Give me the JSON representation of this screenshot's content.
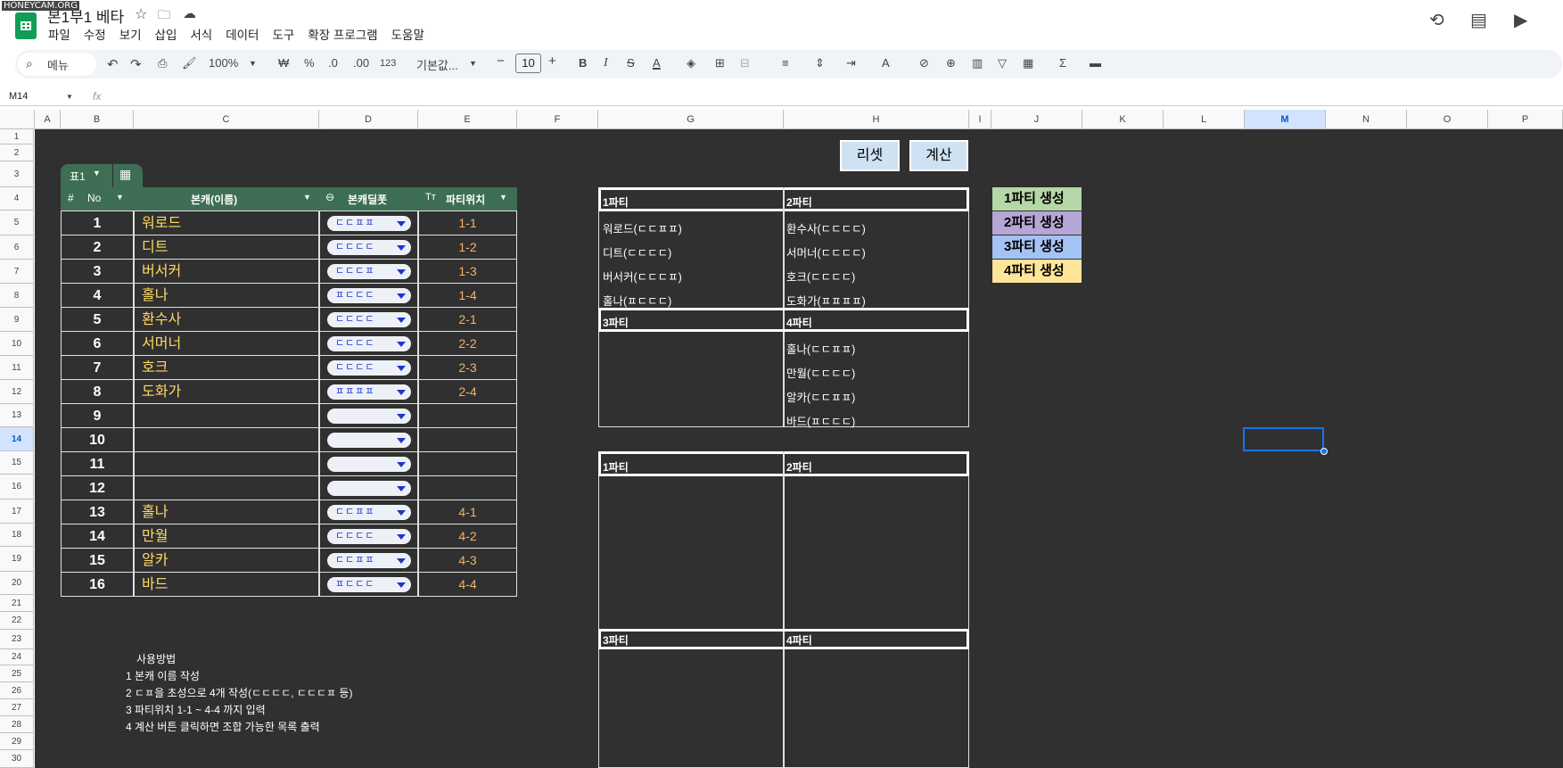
{
  "watermark": "HONEYCAM.ORG",
  "doc": {
    "title": "본1부1 베타"
  },
  "menu": [
    "파일",
    "수정",
    "보기",
    "삽입",
    "서식",
    "데이터",
    "도구",
    "확장 프로그램",
    "도움말"
  ],
  "toolbar": {
    "search_label": "메뉴",
    "zoom": "100%",
    "currency": "₩",
    "percent": "%",
    "dec_decrease": ".0",
    "dec_increase": ".00",
    "number_format": "123",
    "font": "기본값...",
    "font_size": "10"
  },
  "name_box": "M14",
  "fx_label": "fx",
  "columns": [
    "A",
    "B",
    "C",
    "D",
    "E",
    "F",
    "G",
    "H",
    "I",
    "J",
    "K",
    "L",
    "M",
    "N",
    "O",
    "P"
  ],
  "rows": [
    "1",
    "2",
    "3",
    "4",
    "5",
    "6",
    "7",
    "8",
    "9",
    "10",
    "11",
    "12",
    "13",
    "14",
    "15",
    "16",
    "17",
    "18",
    "19",
    "20",
    "21",
    "22",
    "23",
    "24",
    "25",
    "26",
    "27",
    "28",
    "29",
    "30"
  ],
  "buttons": {
    "reset": "리셋",
    "calc": "계산"
  },
  "table": {
    "tab_label": "표1",
    "headers": {
      "no": "No",
      "name": "본캐(이름)",
      "type": "본캐딜폿",
      "pos": "파티위치"
    },
    "rows": [
      {
        "no": "1",
        "name": "워로드",
        "chip": "ㄷㄷㅍㅍ",
        "pos": "1-1"
      },
      {
        "no": "2",
        "name": "디트",
        "chip": "ㄷㄷㄷㄷ",
        "pos": "1-2"
      },
      {
        "no": "3",
        "name": "버서커",
        "chip": "ㄷㄷㄷㅍ",
        "pos": "1-3"
      },
      {
        "no": "4",
        "name": "홀나",
        "chip": "ㅍㄷㄷㄷ",
        "pos": "1-4"
      },
      {
        "no": "5",
        "name": "환수사",
        "chip": "ㄷㄷㄷㄷ",
        "pos": "2-1"
      },
      {
        "no": "6",
        "name": "서머너",
        "chip": "ㄷㄷㄷㄷ",
        "pos": "2-2"
      },
      {
        "no": "7",
        "name": "호크",
        "chip": "ㄷㄷㄷㄷ",
        "pos": "2-3"
      },
      {
        "no": "8",
        "name": "도화가",
        "chip": "ㅍㅍㅍㅍ",
        "pos": "2-4"
      },
      {
        "no": "9",
        "name": "",
        "chip": "",
        "pos": ""
      },
      {
        "no": "10",
        "name": "",
        "chip": "",
        "pos": ""
      },
      {
        "no": "11",
        "name": "",
        "chip": "",
        "pos": ""
      },
      {
        "no": "12",
        "name": "",
        "chip": "",
        "pos": ""
      },
      {
        "no": "13",
        "name": "홀나",
        "chip": "ㄷㄷㅍㅍ",
        "pos": "4-1"
      },
      {
        "no": "14",
        "name": "만월",
        "chip": "ㄷㄷㄷㄷ",
        "pos": "4-2"
      },
      {
        "no": "15",
        "name": "알카",
        "chip": "ㄷㄷㅍㅍ",
        "pos": "4-3"
      },
      {
        "no": "16",
        "name": "바드",
        "chip": "ㅍㄷㄷㄷ",
        "pos": "4-4"
      }
    ]
  },
  "result1": {
    "p1": {
      "label": "1파티",
      "items": [
        "워로드(ㄷㄷㅍㅍ)",
        "디트(ㄷㄷㄷㄷ)",
        "버서커(ㄷㄷㄷㅍ)",
        "홀나(ㅍㄷㄷㄷ)"
      ]
    },
    "p2": {
      "label": "2파티",
      "items": [
        "환수사(ㄷㄷㄷㄷ)",
        "서머너(ㄷㄷㄷㄷ)",
        "호크(ㄷㄷㄷㄷ)",
        "도화가(ㅍㅍㅍㅍ)"
      ]
    },
    "p3": {
      "label": "3파티",
      "items": []
    },
    "p4": {
      "label": "4파티",
      "items": [
        "홀나(ㄷㄷㅍㅍ)",
        "만월(ㄷㄷㄷㄷ)",
        "알카(ㄷㄷㅍㅍ)",
        "바드(ㅍㄷㄷㄷ)"
      ]
    }
  },
  "result2": {
    "p1": "1파티",
    "p2": "2파티",
    "p3": "3파티",
    "p4": "4파티"
  },
  "generate": [
    {
      "label": "1파티 생성",
      "color": "#b6d7a8"
    },
    {
      "label": "2파티 생성",
      "color": "#b4a7d6"
    },
    {
      "label": "3파티 생성",
      "color": "#a4c2f4"
    },
    {
      "label": "4파티 생성",
      "color": "#ffe599"
    }
  ],
  "howto": {
    "title": "사용방법",
    "steps": [
      "1  본캐 이름 작성",
      "2  ㄷㅍ을 초성으로 4개 작성(ㄷㄷㄷㄷ, ㄷㄷㄷㅍ 등)",
      "3  파티위치 1-1 ~ 4-4 까지 입력",
      "4  계산 버튼 클릭하면 조합 가능한 목록 출력"
    ]
  },
  "colors": {
    "table_header": "#3e6f55",
    "name_text": "#ffd966",
    "pos_text": "#f6b26b",
    "sheet_bg": "#303030"
  }
}
